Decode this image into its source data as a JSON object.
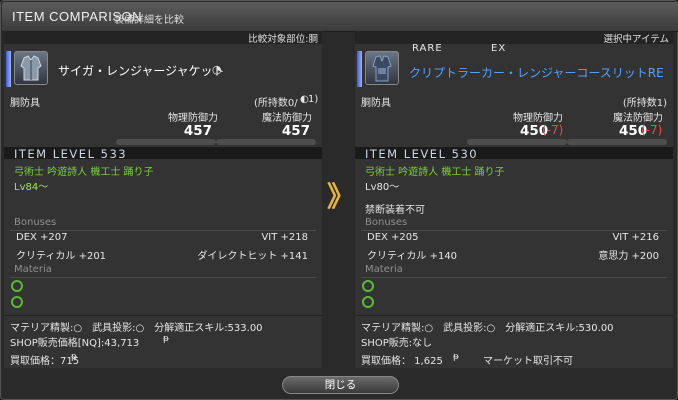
{
  "window": {
    "title": "ITEM COMPARISON",
    "subtitle": "装備詳細を比較",
    "close_label": "閉じる"
  },
  "left": {
    "header": "比較対象部位:胴",
    "name": "サイガ・レンジャージャケット",
    "category": "胴防具",
    "owned": "(所持数0/",
    "owned_hq": "1)",
    "phys_label": "物理防御力",
    "mag_label": "魔法防御力",
    "phys": "457",
    "mag": "457",
    "ilvl": "ITEM LEVEL 533",
    "jobs": "弓術士 吟遊詩人 機工士 踊り子",
    "level": "Lv84〜",
    "bonuses_label": "Bonuses",
    "bonuses": [
      "DEX +207",
      "VIT +218",
      "クリティカル +201",
      "ダイレクトヒット +141"
    ],
    "materia_label": "Materia",
    "repair": "マテリア精製:○　武具投影:○　分解適正スキル:533.00",
    "shop": "SHOP販売価格[NQ]:43,713",
    "gil_icon": "gil-icon",
    "sell": "買取価格：715"
  },
  "right": {
    "header": "選択中アイテム",
    "rare": "RARE",
    "ex": "EX",
    "name": "クリプトラーカー・レンジャーコースリットRE",
    "category": "胴防具",
    "owned": "(所持数1)",
    "phys_label": "物理防御力",
    "mag_label": "魔法防御力",
    "phys": "450",
    "phys_diff": "(-7)",
    "mag": "450",
    "mag_diff": "(-7)",
    "ilvl": "ITEM LEVEL 530",
    "jobs": "弓術士 吟遊詩人 機工士 踊り子",
    "level": "Lv80〜",
    "restriction": "禁断装着不可",
    "bonuses_label": "Bonuses",
    "bonuses": [
      "DEX +205",
      "VIT +216",
      "クリティカル +140",
      "意思力 +200"
    ],
    "materia_label": "Materia",
    "repair": "マテリア精製:○　武具投影:○　分解適正スキル:530.00",
    "shop": "SHOP販売:なし",
    "sell": "買取価格： 1,625",
    "market": "マーケット取引不可"
  },
  "colors": {
    "accent_gold": "#e8b43a",
    "jobs_green": "#7ccf3e",
    "diff_red": "#e84c4c",
    "name_blue": "#4fa3ff"
  }
}
